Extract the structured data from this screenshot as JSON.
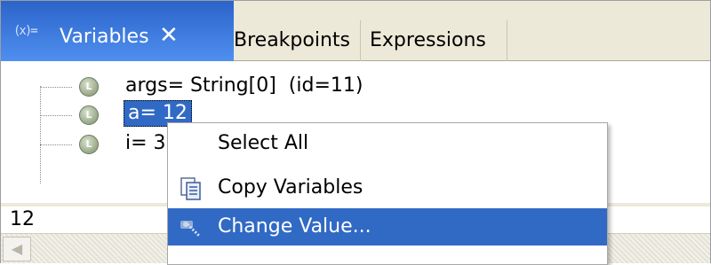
{
  "tabs": {
    "variables": {
      "icon": "(x)=",
      "label": "Variables",
      "close": "✕"
    },
    "breakpoints": {
      "label": "Breakpoints"
    },
    "expressions": {
      "label": "Expressions"
    }
  },
  "tree": {
    "rows": [
      {
        "icon": "variable-icon",
        "text": "args= String[0]  (id=11)"
      },
      {
        "icon": "variable-icon",
        "text": "a= 12",
        "selected": true
      },
      {
        "icon": "variable-icon",
        "text": "i= 3"
      }
    ]
  },
  "detail": {
    "text": "12"
  },
  "context_menu": {
    "items": [
      {
        "label": "Select All",
        "icon": ""
      },
      {
        "label": "Copy Variables",
        "icon": "copy-variables-icon"
      },
      {
        "label": "Change Value...",
        "icon": "change-value-icon",
        "highlighted": true
      }
    ]
  },
  "colors": {
    "active_tab": "#3a76dc",
    "selection": "#316ac5",
    "tab_strip": "#ece9d8"
  }
}
